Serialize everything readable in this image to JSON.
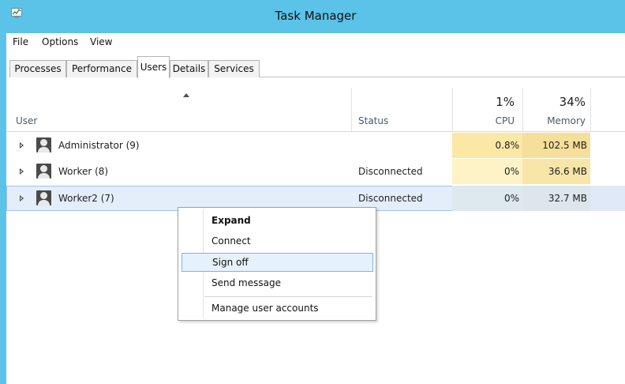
{
  "window": {
    "title": "Task Manager",
    "icon": "task-manager-icon"
  },
  "menu": [
    "File",
    "Options",
    "View"
  ],
  "tabs": [
    "Processes",
    "Performance",
    "Users",
    "Details",
    "Services"
  ],
  "active_tab": "Users",
  "columns": {
    "user": "User",
    "status": "Status",
    "cpu_pct": "1%",
    "cpu": "CPU",
    "mem_pct": "34%",
    "mem": "Memory"
  },
  "rows": [
    {
      "name": "Administrator (9)",
      "status": "",
      "cpu": "0.8%",
      "memory": "102.5 MB"
    },
    {
      "name": "Worker (8)",
      "status": "Disconnected",
      "cpu": "0%",
      "memory": "36.6 MB"
    },
    {
      "name": "Worker2 (7)",
      "status": "Disconnected",
      "cpu": "0%",
      "memory": "32.7 MB"
    }
  ],
  "selected_row": "Worker2 (7)",
  "context_menu": {
    "items": [
      "Expand",
      "Connect",
      "Sign off",
      "Send message",
      "Manage user accounts"
    ],
    "default_item": "Expand",
    "highlighted_item": "Sign off"
  },
  "colors": {
    "titlebar": "#5bc3e8",
    "heat_cpu_high": "#fbe8a5",
    "heat_cpu_low": "#fdf3c6",
    "heat_mem": "#f6df98",
    "selection": "#e4eefb"
  }
}
